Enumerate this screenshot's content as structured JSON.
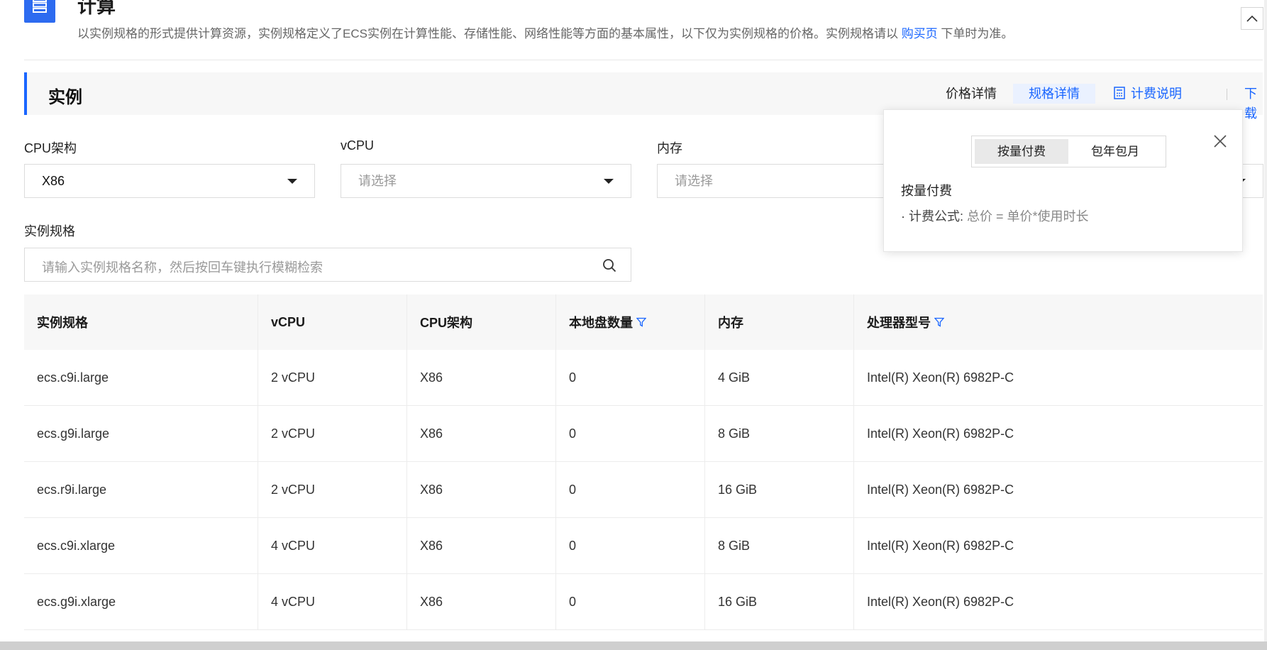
{
  "header": {
    "title": "计算",
    "description": "以实例规格的形式提供计算资源，实例规格定义了ECS实例在计算性能、存储性能、网络性能等方面的基本属性，以下仅为实例规格的价格。实例规格请以",
    "link_text": "购买页",
    "description_suffix": "下单时为准。"
  },
  "section": {
    "title": "实例",
    "tabs": {
      "price_detail": "价格详情",
      "spec_detail": "规格详情",
      "billing_info": "计费说明",
      "download": "下载"
    }
  },
  "filters": {
    "cpu_arch": {
      "label": "CPU架构",
      "value": "X86"
    },
    "vcpu": {
      "label": "vCPU",
      "placeholder": "请选择"
    },
    "memory": {
      "label": "内存",
      "placeholder": "请选择"
    },
    "instance_spec": {
      "label": "实例规格",
      "placeholder": "请输入实例规格名称，然后按回车键执行模糊检索"
    }
  },
  "table": {
    "columns": [
      "实例规格",
      "vCPU",
      "CPU架构",
      "本地盘数量",
      "内存",
      "处理器型号"
    ],
    "rows": [
      [
        "ecs.c9i.large",
        "2 vCPU",
        "X86",
        "0",
        "4 GiB",
        "Intel(R) Xeon(R) 6982P-C"
      ],
      [
        "ecs.g9i.large",
        "2 vCPU",
        "X86",
        "0",
        "8 GiB",
        "Intel(R) Xeon(R) 6982P-C"
      ],
      [
        "ecs.r9i.large",
        "2 vCPU",
        "X86",
        "0",
        "16 GiB",
        "Intel(R) Xeon(R) 6982P-C"
      ],
      [
        "ecs.c9i.xlarge",
        "4 vCPU",
        "X86",
        "0",
        "8 GiB",
        "Intel(R) Xeon(R) 6982P-C"
      ],
      [
        "ecs.g9i.xlarge",
        "4 vCPU",
        "X86",
        "0",
        "16 GiB",
        "Intel(R) Xeon(R) 6982P-C"
      ]
    ]
  },
  "popover": {
    "options": [
      "按量付费",
      "包年包月"
    ],
    "selected": "按量付费",
    "title": "按量付费",
    "formula_label": "· 计费公式:",
    "formula": "总价 = 单价*使用时长"
  },
  "colors": {
    "accent": "#1a66ff",
    "header_icon": "#2d6bf0"
  }
}
